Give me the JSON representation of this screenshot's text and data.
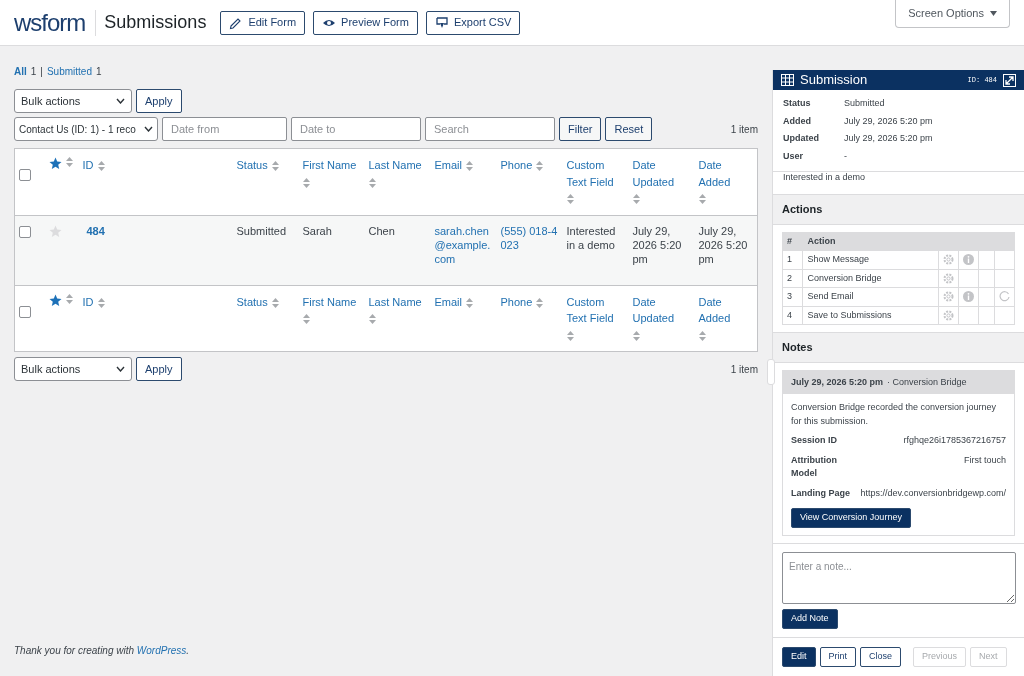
{
  "header": {
    "logo": "wsform",
    "title": "Submissions",
    "buttons": [
      "Edit Form",
      "Preview Form",
      "Export CSV"
    ],
    "screen_options": "Screen Options"
  },
  "views": {
    "separator": "|",
    "items": [
      {
        "label": "All",
        "count": "1",
        "selected": true
      },
      {
        "label": "Submitted",
        "count": "1",
        "selected": false
      }
    ]
  },
  "bulk_top": {
    "select": "Bulk actions",
    "button": "Apply"
  },
  "filters": {
    "form": "Contact Us (ID: 1) - 1 reco",
    "date_from": {
      "placeholder": "Date from"
    },
    "date_to": {
      "placeholder": "Date to"
    },
    "search": {
      "placeholder": "Search"
    },
    "buttons": [
      "Filter",
      "Reset"
    ],
    "count": "1 item"
  },
  "table": {
    "header": {
      "checked": false,
      "starred": true,
      "columns": [
        "ID",
        "Status",
        "First Name",
        "Last Name",
        "Email",
        "Phone",
        "Custom Text Field",
        "Date Updated",
        "Date Added"
      ]
    },
    "rows": [
      {
        "checked": false,
        "starred": false,
        "cells": [
          {
            "kind": "id",
            "text": "484"
          },
          {
            "kind": "text",
            "text": "Submitted"
          },
          {
            "kind": "text",
            "text": "Sarah"
          },
          {
            "kind": "text",
            "text": "Chen"
          },
          {
            "kind": "link",
            "text": "sarah.chen@example.com"
          },
          {
            "kind": "link",
            "text": "(555) 018-4023"
          },
          {
            "kind": "text",
            "text": "Interested in a demo"
          },
          {
            "kind": "text",
            "text": "July 29, 2026 5:20 pm"
          },
          {
            "kind": "text",
            "text": "July 29, 2026 5:20 pm"
          }
        ]
      }
    ],
    "footer": {
      "checked": false,
      "starred": true,
      "columns": [
        "ID",
        "Status",
        "First Name",
        "Last Name",
        "Email",
        "Phone",
        "Custom Text Field",
        "Date Updated",
        "Date Added"
      ]
    }
  },
  "bulk_bottom": {
    "select": "Bulk actions",
    "button": "Apply",
    "count": "1 item"
  },
  "credit": {
    "text": "Thank you for creating with ",
    "link": "WordPress",
    "end": "."
  },
  "panel": {
    "title": "Submission",
    "id": "ID: 484",
    "fields": [
      {
        "label": "Status",
        "value": "Submitted"
      },
      {
        "label": "Added",
        "value": "July 29, 2026 5:20 pm"
      },
      {
        "label": "Updated",
        "value": "July 29, 2026 5:20 pm"
      },
      {
        "label": "User",
        "value": "-"
      }
    ],
    "overflow_text": "Interested in a demo",
    "actions": {
      "heading": "Actions",
      "columns": [
        "#",
        "Action"
      ],
      "rows": [
        {
          "number": "1",
          "action": "Show Message",
          "info": true,
          "spinner": false
        },
        {
          "number": "2",
          "action": "Conversion Bridge",
          "info": false,
          "spinner": false
        },
        {
          "number": "3",
          "action": "Send Email",
          "info": true,
          "spinner": true
        },
        {
          "number": "4",
          "action": "Save to Submissions",
          "info": false,
          "spinner": false
        }
      ]
    },
    "notes": {
      "heading": "Notes",
      "note": {
        "date": "July 29, 2026 5:20 pm",
        "source": "· Conversion Bridge",
        "text": "Conversion Bridge recorded the conversion journey for this submission.",
        "details": [
          {
            "label": "Session ID",
            "value": "rfghqe26i1785367216757"
          },
          {
            "label": "Attribution Model",
            "value": "First touch"
          },
          {
            "label": "Landing Page",
            "value": "https://dev.conversionbridgewp.com/"
          }
        ],
        "button": "View Conversion Journey"
      },
      "input": {
        "placeholder": "Enter a note..."
      },
      "add_button": "Add Note"
    },
    "buttons": [
      {
        "label": "Edit",
        "kind": "primary",
        "disabled": false
      },
      {
        "label": "Print",
        "kind": "outline",
        "disabled": false
      },
      {
        "label": "Close",
        "kind": "outline",
        "disabled": false
      },
      {
        "label": "Previous",
        "kind": "outline",
        "disabled": true
      },
      {
        "label": "Next",
        "kind": "outline",
        "disabled": true
      }
    ]
  }
}
